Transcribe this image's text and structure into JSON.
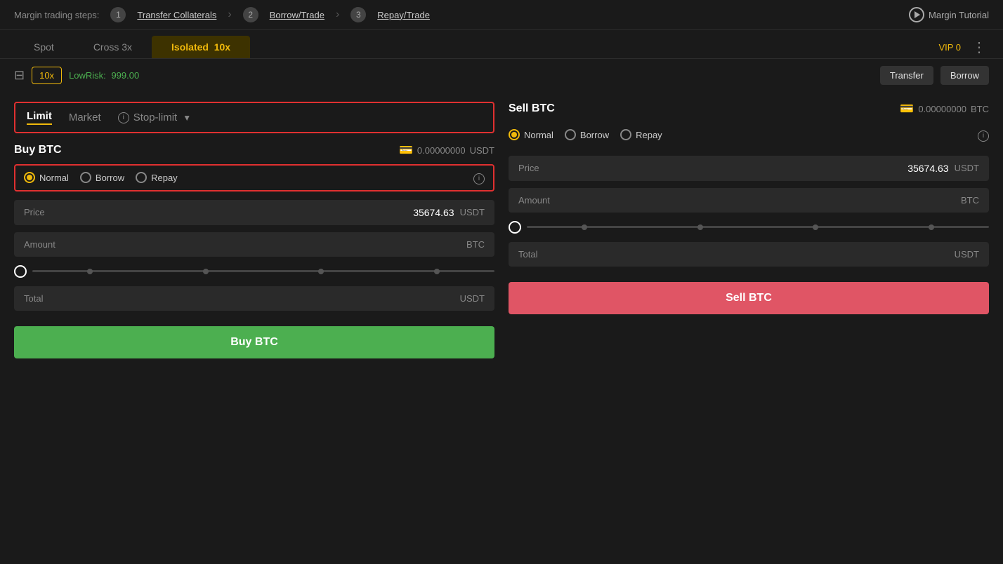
{
  "topNav": {
    "label": "Margin trading steps:",
    "step1_num": "1",
    "step1_label": "Transfer Collaterals",
    "step2_num": "2",
    "step2_label": "Borrow/Trade",
    "step3_num": "3",
    "step3_label": "Repay/Trade",
    "tutorial_label": "Margin Tutorial"
  },
  "tabs": {
    "spot": "Spot",
    "cross": "Cross 3x",
    "isolated": "Isolated",
    "isolated_leverage": "10x"
  },
  "toolbar": {
    "vip": "VIP 0",
    "calc_icon": "⊟",
    "leverage": "10x",
    "lowrisk_label": "LowRisk:",
    "lowrisk_value": "999.00",
    "transfer_label": "Transfer",
    "borrow_label": "Borrow"
  },
  "buy": {
    "title": "Buy BTC",
    "balance": "0.00000000",
    "balance_unit": "USDT",
    "order_types": {
      "limit": "Limit",
      "market": "Market",
      "stop_limit": "Stop-limit"
    },
    "radio": {
      "normal": "Normal",
      "borrow": "Borrow",
      "repay": "Repay"
    },
    "price_label": "Price",
    "price_value": "35674.63",
    "price_unit": "USDT",
    "amount_label": "Amount",
    "amount_unit": "BTC",
    "total_label": "Total",
    "total_unit": "USDT",
    "button": "Buy BTC"
  },
  "sell": {
    "title": "Sell BTC",
    "balance": "0.00000000",
    "balance_unit": "BTC",
    "radio": {
      "normal": "Normal",
      "borrow": "Borrow",
      "repay": "Repay"
    },
    "price_label": "Price",
    "price_value": "35674.63",
    "price_unit": "USDT",
    "amount_label": "Amount",
    "amount_unit": "BTC",
    "total_label": "Total",
    "total_unit": "USDT",
    "button": "Sell BTC"
  }
}
